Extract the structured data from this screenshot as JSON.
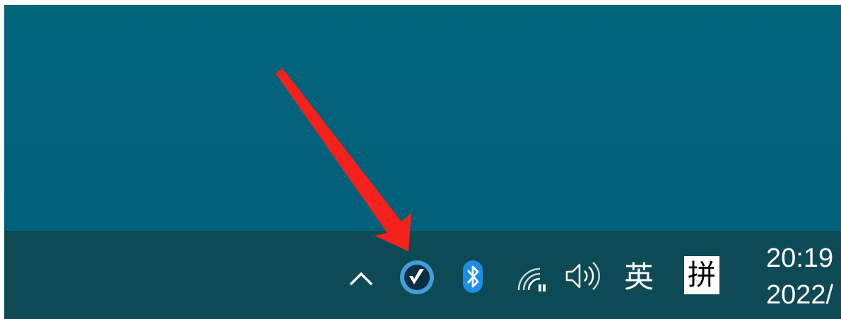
{
  "desktop": {
    "background_color": "#01637a"
  },
  "taskbar": {
    "background_color": "#0d4a55",
    "tray": {
      "show_hidden_icon": "chevron-up-icon",
      "manager_icon": "checkmark-app-icon",
      "bluetooth_icon": "bluetooth-icon",
      "wifi_icon": "wifi-icon",
      "volume_icon": "speaker-icon",
      "ime_language": "英",
      "ime_mode": "拼"
    },
    "clock": {
      "time": "20:19",
      "date": "2022/"
    }
  },
  "annotation": {
    "arrow_color": "#f5211c"
  }
}
